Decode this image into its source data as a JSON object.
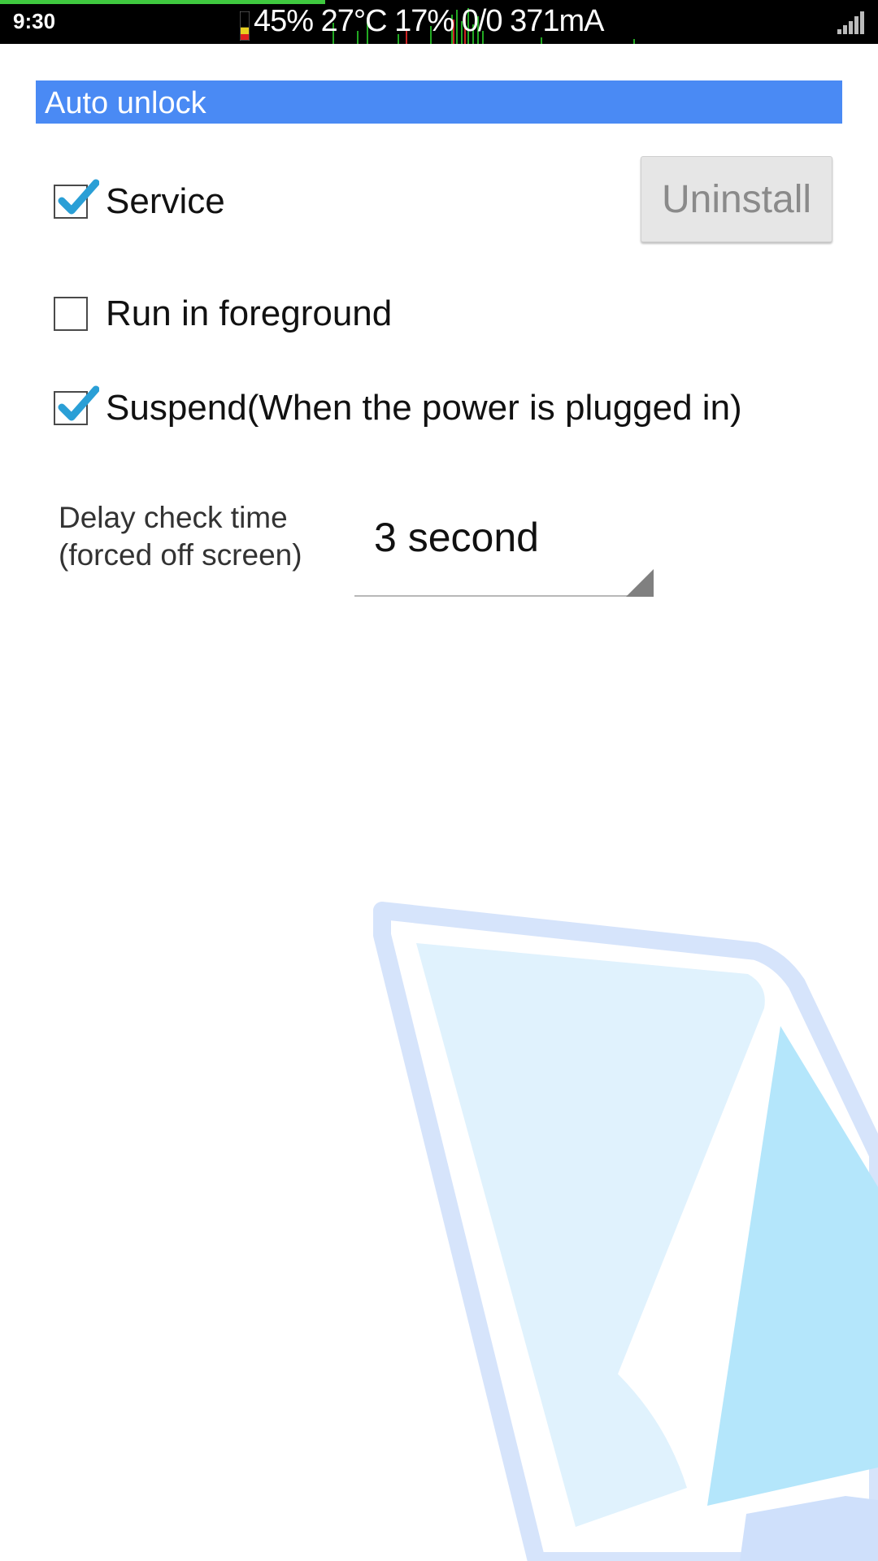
{
  "status_bar": {
    "time": "9:30",
    "info": "45% 27°C 17% 0/0 371mA",
    "battery_level": 0.45,
    "progress_fraction": 0.37,
    "icons": [
      "battery-icon",
      "cpu-graph-icon",
      "signal-icon"
    ]
  },
  "header": {
    "title": "Auto unlock"
  },
  "options": {
    "service": {
      "label": "Service",
      "checked": true
    },
    "foreground": {
      "label": "Run in foreground",
      "checked": false
    },
    "suspend": {
      "label": "Suspend(When the power is plugged in)",
      "checked": true
    }
  },
  "uninstall": {
    "label": "Uninstall"
  },
  "delay": {
    "label_line1": "Delay check time",
    "label_line2": "(forced off screen)",
    "value": "3 second"
  },
  "colors": {
    "accent": "#4a8af4",
    "check": "#2a9fd6",
    "status_bar": "#000000"
  }
}
